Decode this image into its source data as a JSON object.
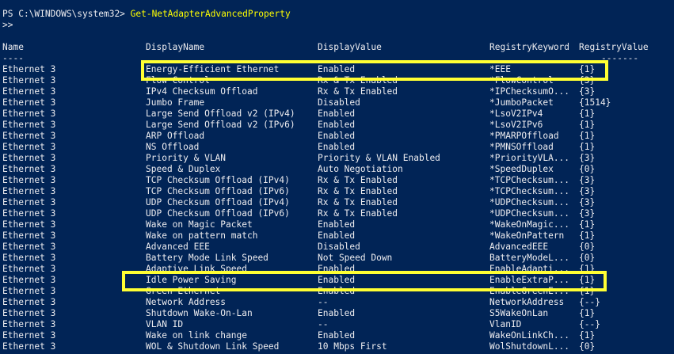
{
  "prompt": {
    "ps_prefix": "PS C:\\WINDOWS\\system32> ",
    "command": "Get-NetAdapterAdvancedProperty",
    "continuation": ">>"
  },
  "columns": {
    "headers": [
      "Name",
      "DisplayName",
      "DisplayValue",
      "RegistryKeyword",
      "RegistryValue"
    ],
    "separators": [
      "----",
      "",
      "",
      "",
      "-------"
    ]
  },
  "rows": [
    [
      "Ethernet 3",
      "Energy-Efficient Ethernet",
      "Enabled",
      "*EEE",
      "{1}"
    ],
    [
      "Ethernet 3",
      "Flow Control",
      "Rx & Tx Enabled",
      "*FlowControl",
      "{3}"
    ],
    [
      "Ethernet 3",
      "IPv4 Checksum Offload",
      "Rx & Tx Enabled",
      "*IPChecksumO...",
      "{3}"
    ],
    [
      "Ethernet 3",
      "Jumbo Frame",
      "Disabled",
      "*JumboPacket",
      "{1514}"
    ],
    [
      "Ethernet 3",
      "Large Send Offload v2 (IPv4)",
      "Enabled",
      "*LsoV2IPv4",
      "{1}"
    ],
    [
      "Ethernet 3",
      "Large Send Offload v2 (IPv6)",
      "Enabled",
      "*LsoV2IPv6",
      "{1}"
    ],
    [
      "Ethernet 3",
      "ARP Offload",
      "Enabled",
      "*PMARPOffload",
      "{1}"
    ],
    [
      "Ethernet 3",
      "NS Offload",
      "Enabled",
      "*PMNSOffload",
      "{1}"
    ],
    [
      "Ethernet 3",
      "Priority & VLAN",
      "Priority & VLAN Enabled",
      "*PriorityVLA...",
      "{3}"
    ],
    [
      "Ethernet 3",
      "Speed & Duplex",
      "Auto Negotiation",
      "*SpeedDuplex",
      "{0}"
    ],
    [
      "Ethernet 3",
      "TCP Checksum Offload (IPv4)",
      "Rx & Tx Enabled",
      "*TCPChecksum...",
      "{3}"
    ],
    [
      "Ethernet 3",
      "TCP Checksum Offload (IPv6)",
      "Rx & Tx Enabled",
      "*TCPChecksum...",
      "{3}"
    ],
    [
      "Ethernet 3",
      "UDP Checksum Offload (IPv4)",
      "Rx & Tx Enabled",
      "*UDPChecksum...",
      "{3}"
    ],
    [
      "Ethernet 3",
      "UDP Checksum Offload (IPv6)",
      "Rx & Tx Enabled",
      "*UDPChecksum...",
      "{3}"
    ],
    [
      "Ethernet 3",
      "Wake on Magic Packet",
      "Enabled",
      "*WakeOnMagic...",
      "{1}"
    ],
    [
      "Ethernet 3",
      "Wake on pattern match",
      "Enabled",
      "*WakeOnPattern",
      "{1}"
    ],
    [
      "Ethernet 3",
      "Advanced EEE",
      "Disabled",
      "AdvancedEEE",
      "{0}"
    ],
    [
      "Ethernet 3",
      "Battery Mode Link Speed",
      "Not Speed Down",
      "BatteryModeL...",
      "{0}"
    ],
    [
      "Ethernet 3",
      "Adaptive Link Speed",
      "Enabled",
      "EnableAdapti...",
      "{1}"
    ],
    [
      "Ethernet 3",
      "Idle Power Saving",
      "Enabled",
      "EnableExtraP...",
      "{1}"
    ],
    [
      "Ethernet 3",
      "Green Ethernet",
      "Enabled",
      "EnableGreenE...",
      "{1}"
    ],
    [
      "Ethernet 3",
      "Network Address",
      "--",
      "NetworkAddress",
      "{--}"
    ],
    [
      "Ethernet 3",
      "Shutdown Wake-On-Lan",
      "Enabled",
      "S5WakeOnLan",
      "{1}"
    ],
    [
      "Ethernet 3",
      "VLAN ID",
      "--",
      "VlanID",
      "{--}"
    ],
    [
      "Ethernet 3",
      "Wake on link change",
      "Enabled",
      "WakeOnLinkCh...",
      "{1}"
    ],
    [
      "Ethernet 3",
      "WOL & Shutdown Link Speed",
      "10 Mbps First",
      "WolShutdownL...",
      "{0}"
    ]
  ],
  "highlighted_rows": [
    0,
    19
  ],
  "colors": {
    "background": "#012456",
    "text": "#eeedf0",
    "command": "#ffff00",
    "highlight": "#ffff33"
  }
}
